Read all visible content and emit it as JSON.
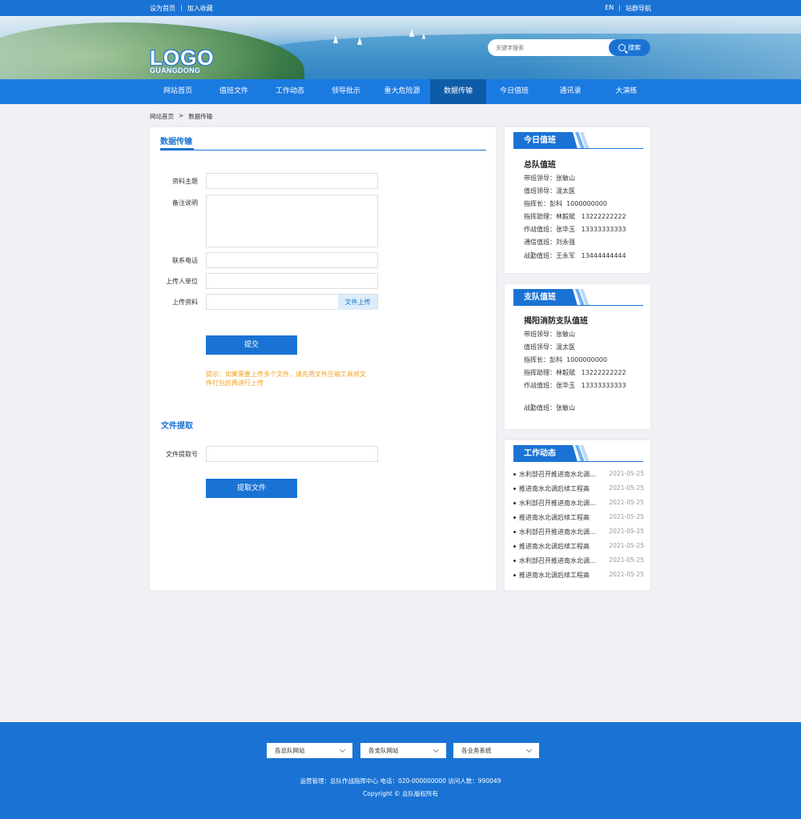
{
  "topbar": {
    "left": [
      "设为首页",
      "加入收藏"
    ],
    "right": [
      "EN",
      "站群导航"
    ]
  },
  "logo": {
    "line1": "LOGO",
    "line2": "GUANGDONG"
  },
  "search": {
    "placeholder": "关键字搜索",
    "button": "搜索"
  },
  "nav": {
    "items": [
      "网站首页",
      "值班文件",
      "工作动态",
      "领导批示",
      "重大危险源",
      "数据传输",
      "今日值班",
      "通讯录",
      "大演练"
    ],
    "active_index": 5
  },
  "breadcrumb": {
    "home": "网站首页",
    "sep": ">",
    "current": "数据传输"
  },
  "main": {
    "title": "数据传输",
    "labels": {
      "subject": "资料主题",
      "remark": "备注说明",
      "phone": "联系电话",
      "unit": "上传人单位",
      "file": "上传资料"
    },
    "upload_button": "文件上传",
    "submit": "提交",
    "tip_line1": "提示：如果需要上传多个文件，请先用文件压缩工具将文",
    "tip_line2": "件打包后再进行上传",
    "extract_title": "文件提取",
    "extract_label": "文件提取号",
    "extract_button": "提取文件"
  },
  "today_duty": {
    "tab": "今日值班",
    "title": "总队值班",
    "lines": [
      "带班领导：张敏山",
      "值班领导：温太医",
      "指挥长：彭科  1000000000",
      "指挥助理：林毅斌   13222222222",
      "作战值班：张华玉   13333333333",
      "通信值班：刘永强",
      "战勤值班：王永军   13444444444"
    ]
  },
  "branch_duty": {
    "tab": "支队值班",
    "title": "揭阳消防支队值班",
    "lines": [
      "带班领导：张敏山",
      "值班领导：温太医",
      "指挥长：彭科  1000000000",
      "指挥助理：林毅斌   13222222222",
      "作战值班：张华玉   13333333333",
      "战勤值班：张敏山"
    ]
  },
  "work_news": {
    "tab": "工作动态",
    "items": [
      {
        "title": "水利部召开推进南水北调...",
        "date": "2021-05-25"
      },
      {
        "title": "推进南水北调后续工程高",
        "date": "2021-05-25"
      },
      {
        "title": "水利部召开推进南水北调...",
        "date": "2021-05-25"
      },
      {
        "title": "推进南水北调后续工程高",
        "date": "2021-05-25"
      },
      {
        "title": "水利部召开推进南水北调...",
        "date": "2021-05-25"
      },
      {
        "title": "推进南水北调后续工程高",
        "date": "2021-05-25"
      },
      {
        "title": "水利部召开推进南水北调...",
        "date": "2021-05-25"
      },
      {
        "title": "推进南水北调后续工程高",
        "date": "2021-05-25"
      }
    ]
  },
  "footer": {
    "selects": [
      "各总队网站",
      "各支队网站",
      "各业务系统"
    ],
    "info": "运营管理：总队作战指挥中心   电话：020-000000000   访问人数：990049",
    "copyright": "Copyright © 总队版权所有"
  }
}
